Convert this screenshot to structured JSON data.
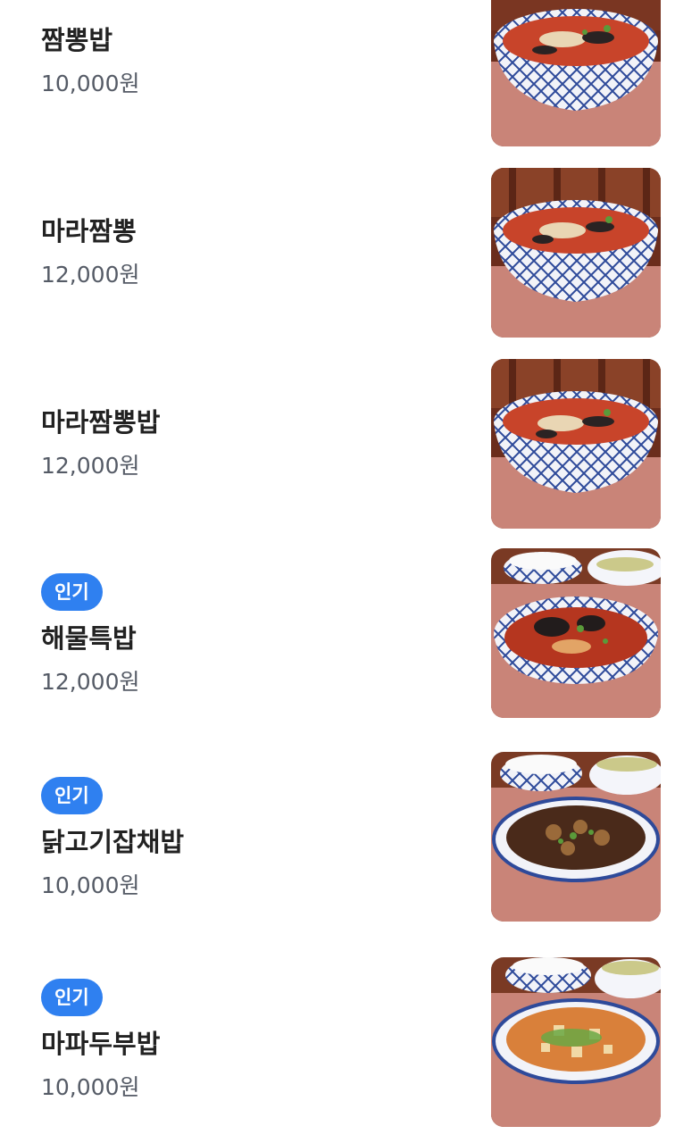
{
  "menu": {
    "items": [
      {
        "name": "짬뽕밥",
        "price": "10,000원",
        "badge": null,
        "image": "jjamppong-bowl-photo"
      },
      {
        "name": "마라짬뽕",
        "price": "12,000원",
        "badge": null,
        "image": "jjamppong-bowl-photo"
      },
      {
        "name": "마라짬뽕밥",
        "price": "12,000원",
        "badge": null,
        "image": "jjamppong-bowl-photo"
      },
      {
        "name": "해물특밥",
        "price": "12,000원",
        "badge": "인기",
        "image": "seafood-rice-bowl-photo"
      },
      {
        "name": "닭고기잡채밥",
        "price": "10,000원",
        "badge": "인기",
        "image": "chicken-japchae-rice-photo"
      },
      {
        "name": "마파두부밥",
        "price": "10,000원",
        "badge": "인기",
        "image": "mapo-tofu-rice-photo"
      }
    ]
  },
  "colors": {
    "badge": "#2f80f0",
    "name": "#222222",
    "price": "#555b66"
  }
}
